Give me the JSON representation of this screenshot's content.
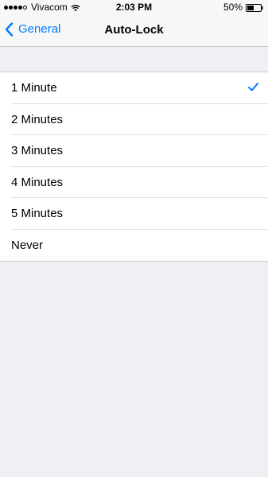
{
  "status_bar": {
    "carrier": "Vivacom",
    "signal_bars_filled": 4,
    "signal_bars_total": 5,
    "time": "2:03 PM",
    "battery_percent": "50%",
    "battery_level": 0.5
  },
  "nav": {
    "back_label": "General",
    "title": "Auto-Lock"
  },
  "options": [
    {
      "label": "1 Minute",
      "selected": true
    },
    {
      "label": "2 Minutes",
      "selected": false
    },
    {
      "label": "3 Minutes",
      "selected": false
    },
    {
      "label": "4 Minutes",
      "selected": false
    },
    {
      "label": "5 Minutes",
      "selected": false
    },
    {
      "label": "Never",
      "selected": false
    }
  ],
  "colors": {
    "accent": "#007aff",
    "background": "#efeff4",
    "bar_background": "#f7f7f7"
  },
  "icons": {
    "back": "chevron-left-icon",
    "selected": "checkmark-icon",
    "wifi": "wifi-icon",
    "battery": "battery-icon"
  }
}
